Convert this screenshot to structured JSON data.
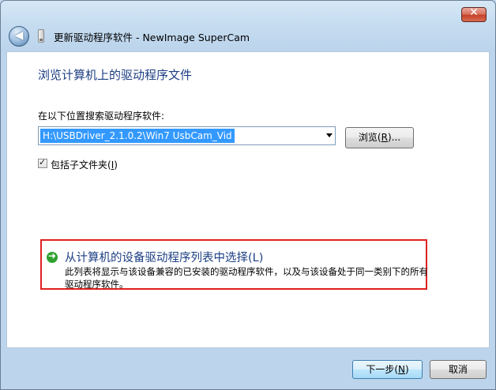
{
  "window": {
    "title": "更新驱动程序软件 - NewImage SuperCam",
    "close_glyph": "✕"
  },
  "header": {
    "back_glyph": "◀",
    "device_icon": "usb-device-icon"
  },
  "main": {
    "heading": "浏览计算机上的驱动程序文件",
    "search_label": "在以下位置搜索驱动程序软件:",
    "path_value": "H:\\USBDriver_2.1.0.2\\Win7 UsbCam_Vid",
    "browse_button": {
      "prefix": "浏览(",
      "mnemonic": "R",
      "suffix": ")..."
    },
    "include_subfolders": {
      "prefix": "包括子文件夹(",
      "mnemonic": "I",
      "suffix": ")",
      "checked": true,
      "check_glyph": "✓"
    },
    "pick_from_list": {
      "arrow_glyph": "➜",
      "title": "从计算机的设备驱动程序列表中选择(L)",
      "description": "此列表将显示与该设备兼容的已安装的驱动程序软件，以及与该设备处于同一类别下的所有驱动程序软件。"
    }
  },
  "footer": {
    "next_button": {
      "prefix": "下一步(",
      "mnemonic": "N",
      "suffix": ")"
    },
    "cancel_button": "取消"
  },
  "colors": {
    "heading": "#1d3f83",
    "highlight_box": "#e02020",
    "selection": "#3399ff",
    "arrow": "#2fa12f"
  }
}
